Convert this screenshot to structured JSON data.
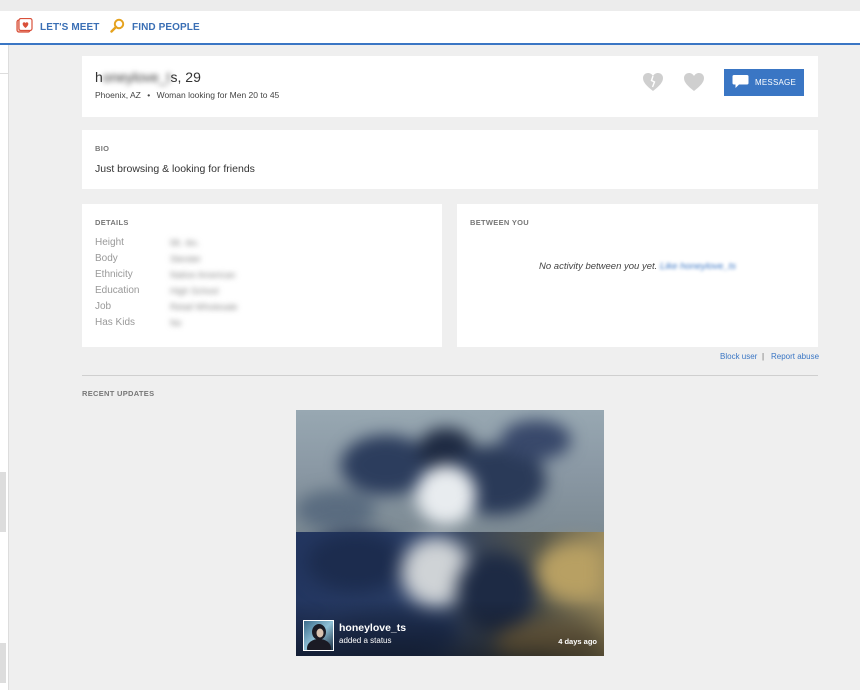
{
  "nav": {
    "lets_meet": "LET'S MEET",
    "find_people": "FIND PEOPLE"
  },
  "profile": {
    "name_first": "h",
    "name_mid": "oneylove_t",
    "name_last": "s",
    "age": ", 29",
    "location": "Phoenix, AZ",
    "bullet": "•",
    "looking_for": "Woman looking for Men 20 to 45",
    "message_label": "MESSAGE",
    "icons": [
      "broken-heart-icon",
      "heart-icon",
      "chat-bubble-icon"
    ]
  },
  "bio": {
    "heading": "BIO",
    "text": "Just browsing & looking for friends"
  },
  "details": {
    "heading": "DETAILS",
    "rows": [
      {
        "label": "Height",
        "value": "5ft. 4in."
      },
      {
        "label": "Body",
        "value": "Slender"
      },
      {
        "label": "Ethnicity",
        "value": "Native American"
      },
      {
        "label": "Education",
        "value": "High School"
      },
      {
        "label": "Job",
        "value": "Retail Wholesale"
      },
      {
        "label": "Has Kids",
        "value": "No"
      }
    ]
  },
  "between": {
    "heading": "BETWEEN YOU",
    "text": "No activity between you yet.",
    "link": "Like honeylove_ts"
  },
  "links": {
    "block": "Block user",
    "sep": "|",
    "report": "Report abuse"
  },
  "recent": {
    "heading": "RECENT UPDATES",
    "user": "honeylove_ts",
    "action": "added a status",
    "time": "4 days ago"
  },
  "colors": {
    "accent": "#3a76c4",
    "background": "#efefef"
  }
}
